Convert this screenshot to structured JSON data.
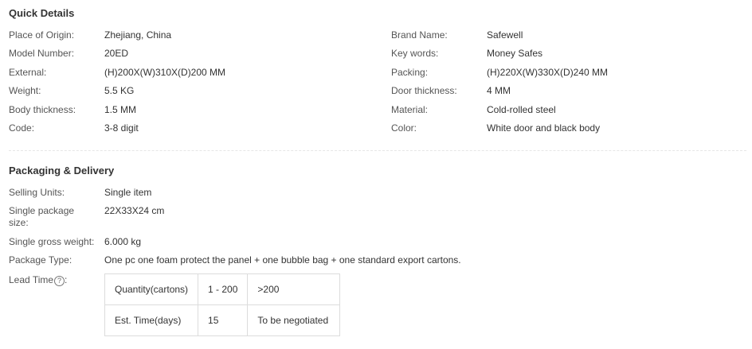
{
  "quick_details": {
    "title": "Quick Details",
    "left": [
      {
        "label": "Place of Origin:",
        "value": "Zhejiang, China"
      },
      {
        "label": "Model Number:",
        "value": "20ED"
      },
      {
        "label": "External:",
        "value": "(H)200X(W)310X(D)200 MM"
      },
      {
        "label": "Weight:",
        "value": "5.5 KG"
      },
      {
        "label": "Body thickness:",
        "value": "1.5 MM"
      },
      {
        "label": "Code:",
        "value": "3-8 digit"
      }
    ],
    "right": [
      {
        "label": "Brand Name:",
        "value": "Safewell"
      },
      {
        "label": "Key words:",
        "value": "Money Safes"
      },
      {
        "label": "Packing:",
        "value": "(H)220X(W)330X(D)240 MM"
      },
      {
        "label": "Door thickness:",
        "value": "4 MM"
      },
      {
        "label": "Material:",
        "value": "Cold-rolled steel"
      },
      {
        "label": "Color:",
        "value": "White door and black body"
      }
    ]
  },
  "packaging": {
    "title": "Packaging & Delivery",
    "selling_units": {
      "label": "Selling Units:",
      "value": "Single item"
    },
    "package_size": {
      "label_line1": "Single package",
      "label_line2": "size:",
      "value": "22X33X24 cm"
    },
    "gross_weight": {
      "label": "Single gross weight:",
      "value": "6.000 kg"
    },
    "package_type": {
      "label": "Package Type:",
      "value": "One pc one foam protect the panel + one bubble bag + one standard export cartons."
    },
    "lead_time": {
      "label": "Lead Time",
      "help_icon": "?",
      "table": {
        "row1": [
          "Quantity(cartons)",
          "1 - 200",
          ">200"
        ],
        "row2": [
          "Est. Time(days)",
          "15",
          "To be negotiated"
        ]
      }
    }
  }
}
